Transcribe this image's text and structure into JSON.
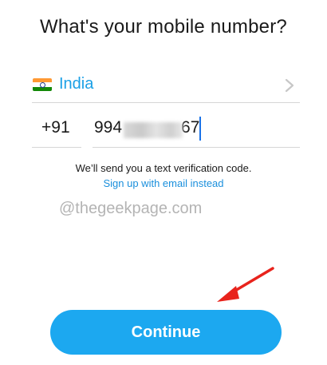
{
  "header": {
    "title": "What's your mobile number?"
  },
  "country": {
    "name": "India",
    "flag_icon": "india-flag-icon",
    "flag_colors": [
      "#ff9933",
      "#ffffff",
      "#138808"
    ],
    "chevron_icon": "chevron-right-icon"
  },
  "phone": {
    "country_code": "+91",
    "number_prefix": "994",
    "number_suffix": "67"
  },
  "hint": {
    "text": "We’ll send you a text verification code.",
    "email_link": "Sign up with email instead"
  },
  "watermark": {
    "text": "@thegeekpage.com"
  },
  "annotation": {
    "arrow_icon": "red-arrow-icon",
    "color": "#e8231c"
  },
  "footer": {
    "continue_label": "Continue"
  },
  "colors": {
    "accent": "#1ca8f0",
    "link": "#1a8fdc",
    "divider": "#d6d6d6"
  }
}
